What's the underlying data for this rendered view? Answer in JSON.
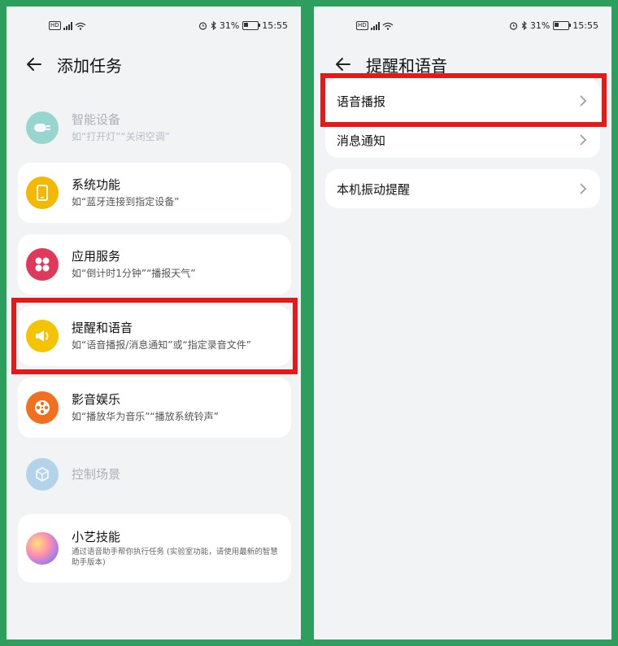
{
  "status": {
    "battery": "31%",
    "time": "15:55",
    "hd": "HD"
  },
  "left": {
    "title": "添加任务",
    "items": [
      {
        "title": "智能设备",
        "subtitle": "如“打开灯”“关闭空调”",
        "icon": "plug-icon",
        "color": "#2bb5a0",
        "disabled": true
      },
      {
        "title": "系统功能",
        "subtitle": "如“蓝牙连接到指定设备”",
        "icon": "phone-icon",
        "color": "#f5b800"
      },
      {
        "title": "应用服务",
        "subtitle": "如“倒计时1分钟”“播报天气”",
        "icon": "apps-grid-icon",
        "color": "#e0385a"
      },
      {
        "title": "提醒和语音",
        "subtitle": "如“语音播报/消息通知”或“指定录音文件”",
        "icon": "speaker-icon",
        "color": "#f5c400"
      },
      {
        "title": "影音娱乐",
        "subtitle": "如“播放华为音乐”“播放系统铃声”",
        "icon": "film-reel-icon",
        "color": "#f07020"
      },
      {
        "title": "控制场景",
        "subtitle": "",
        "icon": "cube-icon",
        "color": "#6aaee0",
        "disabled": true
      },
      {
        "title": "小艺技能",
        "subtitle": "通过语音助手帮你执行任务 (实验室功能，请使用最新的智慧助手版本)",
        "icon": "celia-orb-icon",
        "color": "#c07ee0"
      }
    ]
  },
  "right": {
    "title": "提醒和语音",
    "items": [
      {
        "label": "语音播报"
      },
      {
        "label": "消息通知"
      },
      {
        "label": "本机振动提醒"
      }
    ]
  },
  "colors": {
    "accent_border": "#2e9e5e",
    "highlight": "#e21a1a"
  }
}
